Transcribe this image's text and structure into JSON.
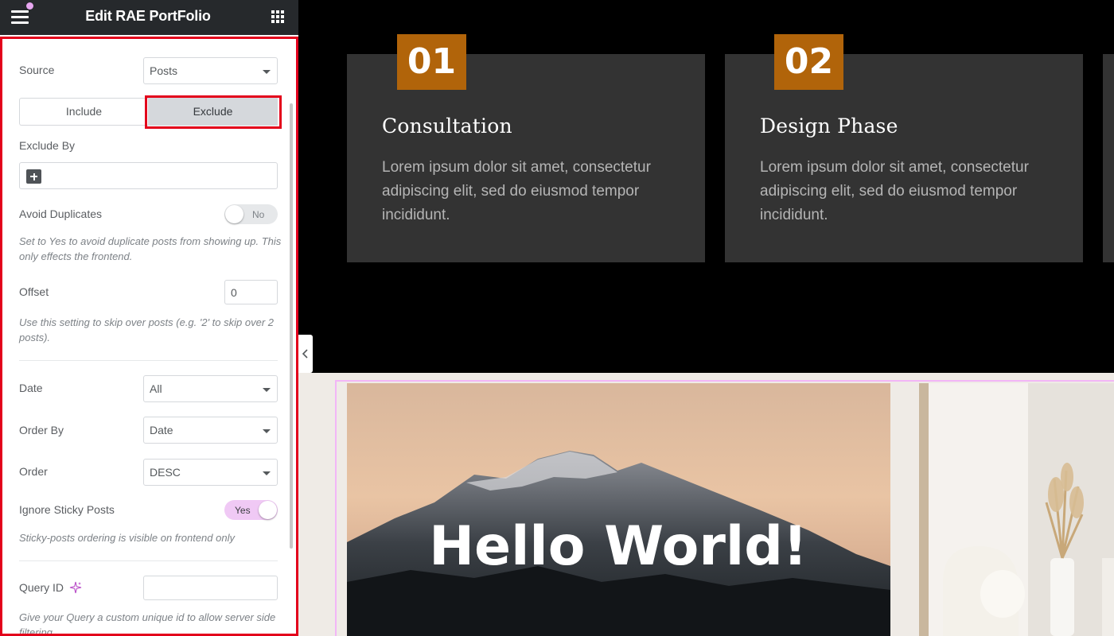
{
  "panel": {
    "title": "Edit RAE PortFolio",
    "source": {
      "label": "Source",
      "value": "Posts"
    },
    "toggle": {
      "include": "Include",
      "exclude": "Exclude"
    },
    "exclude_by": {
      "label": "Exclude By"
    },
    "avoid_duplicates": {
      "label": "Avoid Duplicates",
      "state": "No",
      "help": "Set to Yes to avoid duplicate posts from showing up. This only effects the frontend."
    },
    "offset": {
      "label": "Offset",
      "value": "0",
      "help": "Use this setting to skip over posts (e.g. '2' to skip over 2 posts)."
    },
    "date": {
      "label": "Date",
      "value": "All"
    },
    "order_by": {
      "label": "Order By",
      "value": "Date"
    },
    "order": {
      "label": "Order",
      "value": "DESC"
    },
    "ignore_sticky": {
      "label": "Ignore Sticky Posts",
      "state": "Yes",
      "help": "Sticky-posts ordering is visible on frontend only"
    },
    "query_id": {
      "label": "Query ID",
      "value": "",
      "help": "Give your Query a custom unique id to allow server side filtering"
    }
  },
  "cards": [
    {
      "number": "01",
      "title": "Consultation",
      "body": "Lorem ipsum dolor sit amet, consectetur adipiscing elit, sed do eiusmod tempor incididunt."
    },
    {
      "number": "02",
      "title": "Design Phase",
      "body": "Lorem ipsum dolor sit amet, consectetur adipiscing elit, sed do eiusmod tempor incididunt."
    }
  ],
  "gallery": {
    "hero_text": "Hello World!"
  },
  "colors": {
    "badge": "#b1640a",
    "card_bg": "#333333",
    "highlight": "#e3001b",
    "switch_on": "#f0c9f5",
    "panel_header": "#26292c"
  }
}
